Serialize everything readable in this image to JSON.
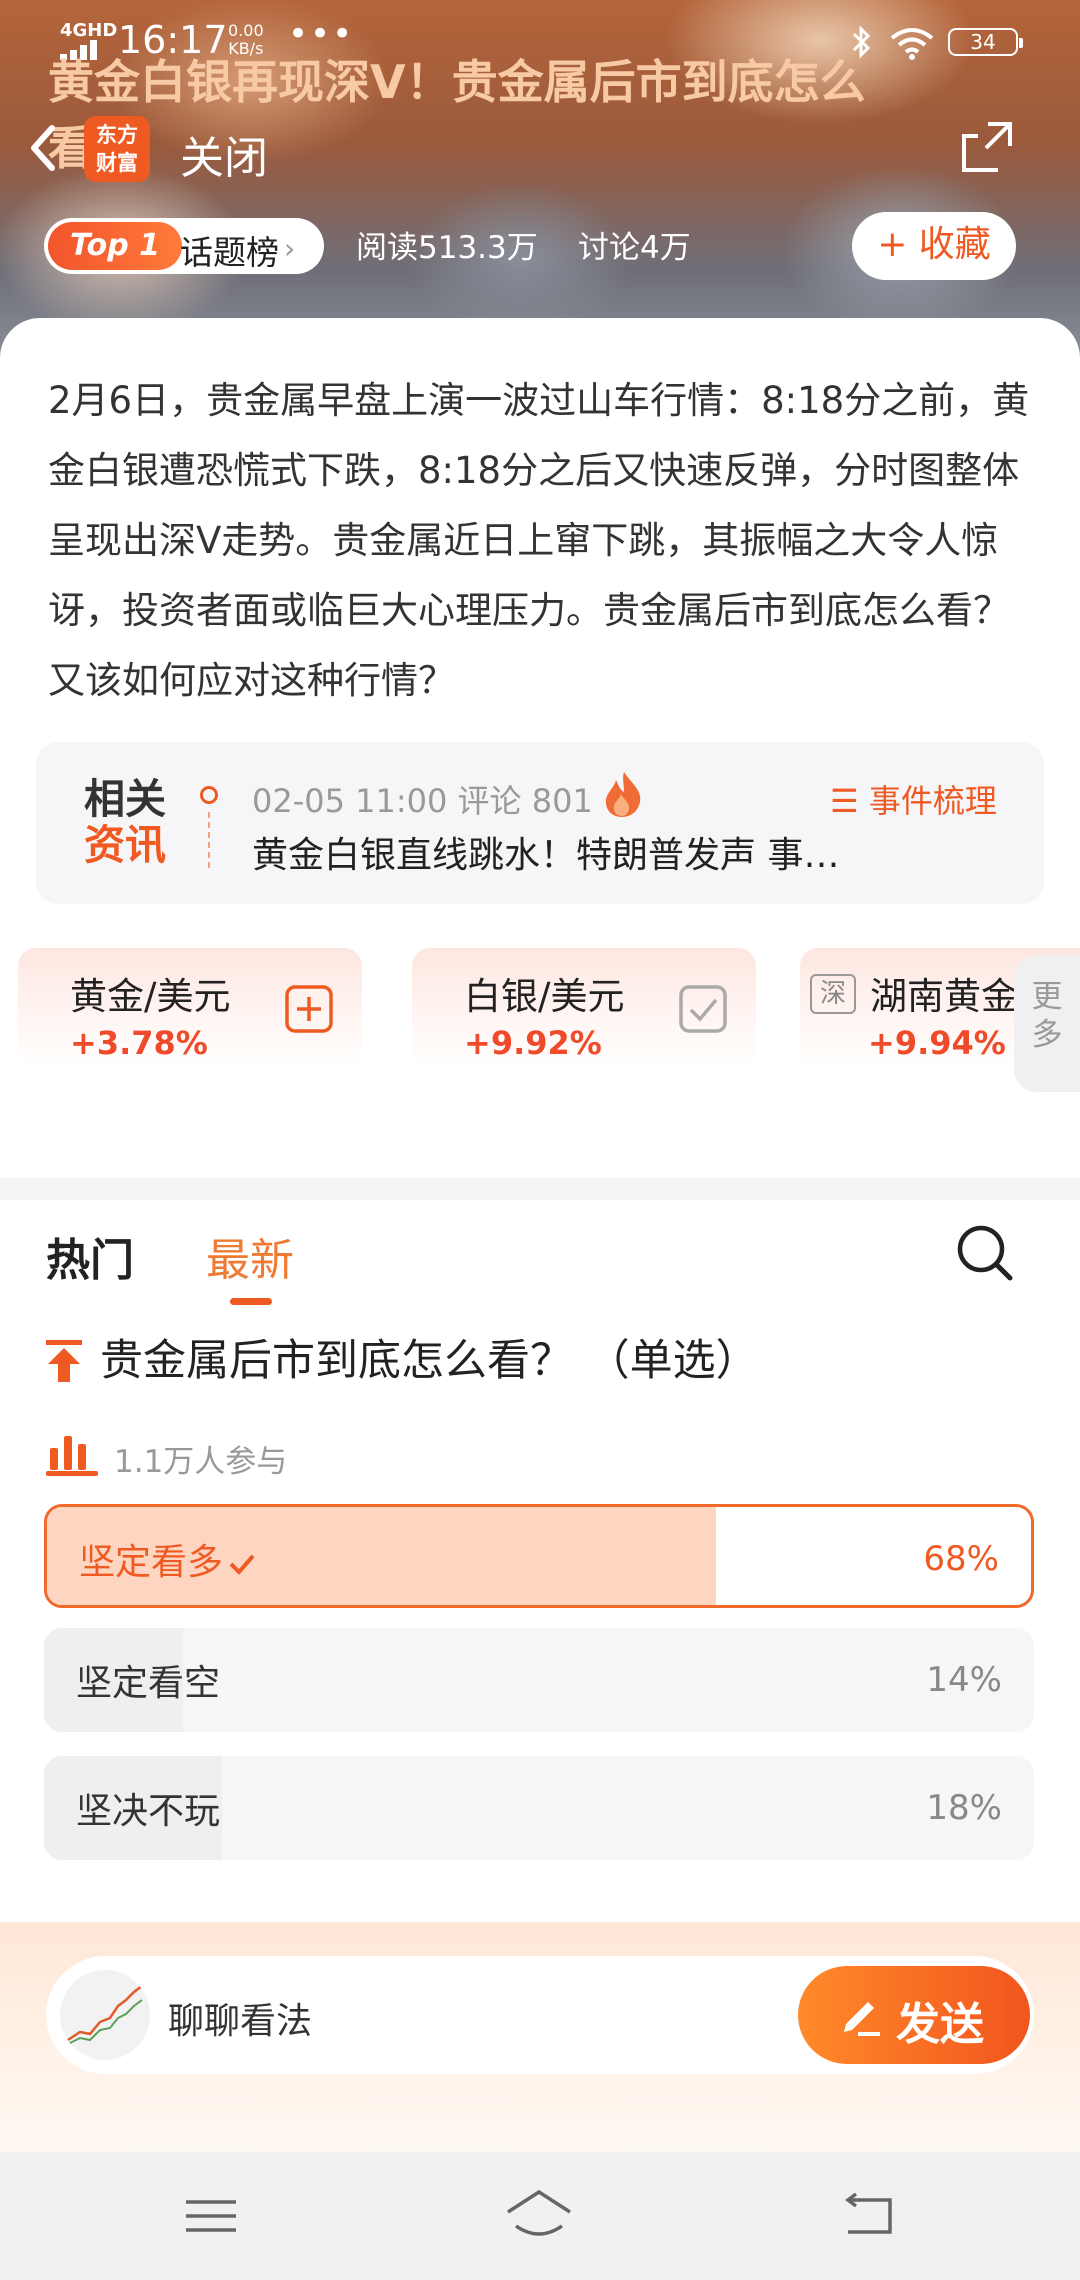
{
  "status_bar": {
    "network": "4GHD",
    "time": "16:17",
    "speed": "0.00",
    "speed_unit": "KB/s",
    "dots": "•••",
    "battery": "34"
  },
  "header": {
    "title": "黄金白银再现深V！贵金属后市到底怎么",
    "title_cont": "看",
    "logo_line1": "东方",
    "logo_line2": "财富",
    "close_label": "关闭"
  },
  "meta": {
    "rank_badge": "Top 1",
    "rank_label": "话题榜",
    "reads": "阅读513.3万",
    "discussions": "讨论4万",
    "favorite_label": "+ 收藏"
  },
  "intro": {
    "text": "2月6日，贵金属早盘上演一波过山车行情：8:18分之前，黄金白银遭恐慌式下跌，8:18分之后又快速反弹，分时图整体呈现出深V走势。贵金属近日上窜下跳，其振幅之大令人惊讶，投资者面或临巨大心理压力。贵金属后市到底怎么看？又该如何应对这种行情？"
  },
  "related": {
    "badge_line1": "相关",
    "badge_line2": "资讯",
    "meta": "02-05 11:00  评论 801",
    "event_label": "☰ 事件梳理",
    "title": "黄金白银直线跳水！特朗普发声 事…"
  },
  "quotes": [
    {
      "name": "黄金/美元",
      "change": "+3.78%",
      "action": "add"
    },
    {
      "name": "白银/美元",
      "change": "+9.92%",
      "action": "added"
    },
    {
      "tag": "深",
      "name": "湖南黄金",
      "change": "+9.94%"
    }
  ],
  "more_label_1": "更",
  "more_label_2": "多",
  "tabs": {
    "hot": "热门",
    "latest": "最新"
  },
  "poll": {
    "question": "贵金属后市到底怎么看？ （单选）",
    "participants": "1.1万人参与",
    "options": [
      {
        "label": "坚定看多",
        "percent": "68%",
        "fraction": 0.68,
        "selected": true
      },
      {
        "label": "坚定看空",
        "percent": "14%",
        "fraction": 0.14,
        "selected": false
      },
      {
        "label": "坚决不玩",
        "percent": "18%",
        "fraction": 0.18,
        "selected": false
      }
    ]
  },
  "comment": {
    "placeholder": "聊聊看法",
    "send_label": "发送"
  },
  "colors": {
    "accent": "#ef5a23",
    "rise": "#ef4a2a",
    "selected_fill": "#fdd5c1"
  }
}
